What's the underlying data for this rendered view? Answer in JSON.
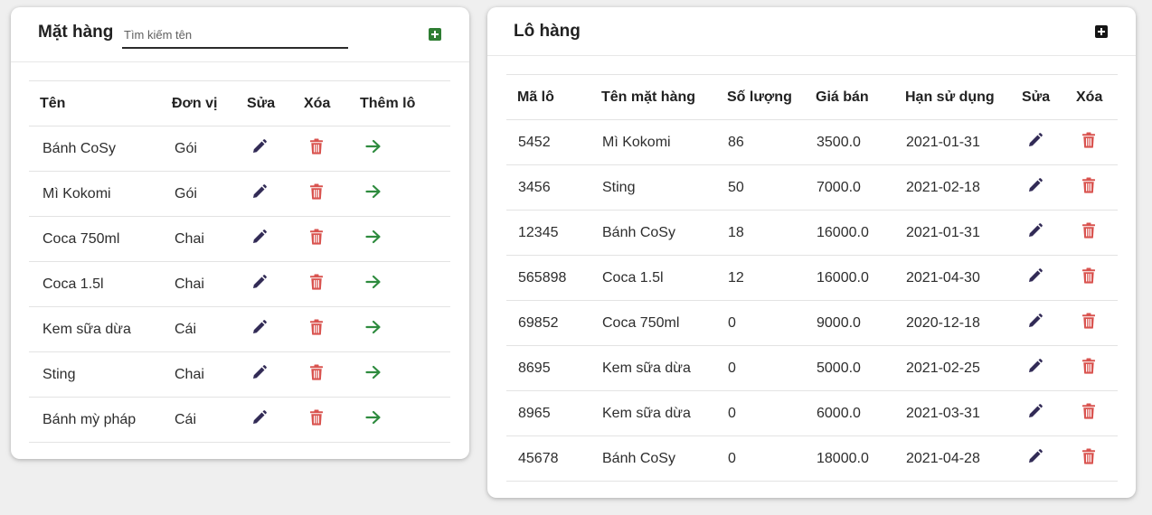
{
  "colors": {
    "edit_icon": "#322b56",
    "delete_icon": "#d9534f",
    "arrow_icon": "#2e8b3e",
    "add_left_bg": "#2e7d32",
    "add_right_bg": "#151515"
  },
  "icons": {
    "edit": "pencil-icon",
    "delete": "trash-icon",
    "add_lot": "arrow-right-icon",
    "add": "plus-square-icon"
  },
  "items_panel": {
    "title": "Mặt hàng",
    "search_placeholder": "Tìm kiếm tên",
    "search_value": "",
    "columns": [
      "Tên",
      "Đơn vị",
      "Sửa",
      "Xóa",
      "Thêm lô"
    ],
    "rows": [
      {
        "name": "Bánh CoSy",
        "unit": "Gói"
      },
      {
        "name": "Mì Kokomi",
        "unit": "Gói"
      },
      {
        "name": "Coca 750ml",
        "unit": "Chai"
      },
      {
        "name": "Coca 1.5l",
        "unit": "Chai"
      },
      {
        "name": "Kem sữa dừa",
        "unit": "Cái"
      },
      {
        "name": "Sting",
        "unit": "Chai"
      },
      {
        "name": "Bánh mỳ pháp",
        "unit": "Cái"
      }
    ]
  },
  "lots_panel": {
    "title": "Lô hàng",
    "columns": [
      "Mã lô",
      "Tên mặt hàng",
      "Số lượng",
      "Giá bán",
      "Hạn sử dụng",
      "Sửa",
      "Xóa"
    ],
    "rows": [
      {
        "code": "5452",
        "item": "Mì Kokomi",
        "qty": "86",
        "price": "3500.0",
        "expiry": "2021-01-31"
      },
      {
        "code": "3456",
        "item": "Sting",
        "qty": "50",
        "price": "7000.0",
        "expiry": "2021-02-18"
      },
      {
        "code": "12345",
        "item": "Bánh CoSy",
        "qty": "18",
        "price": "16000.0",
        "expiry": "2021-01-31"
      },
      {
        "code": "565898",
        "item": "Coca 1.5l",
        "qty": "12",
        "price": "16000.0",
        "expiry": "2021-04-30"
      },
      {
        "code": "69852",
        "item": "Coca 750ml",
        "qty": "0",
        "price": "9000.0",
        "expiry": "2020-12-18"
      },
      {
        "code": "8695",
        "item": "Kem sữa dừa",
        "qty": "0",
        "price": "5000.0",
        "expiry": "2021-02-25"
      },
      {
        "code": "8965",
        "item": "Kem sữa dừa",
        "qty": "0",
        "price": "6000.0",
        "expiry": "2021-03-31"
      },
      {
        "code": "45678",
        "item": "Bánh CoSy",
        "qty": "0",
        "price": "18000.0",
        "expiry": "2021-04-28"
      }
    ]
  }
}
